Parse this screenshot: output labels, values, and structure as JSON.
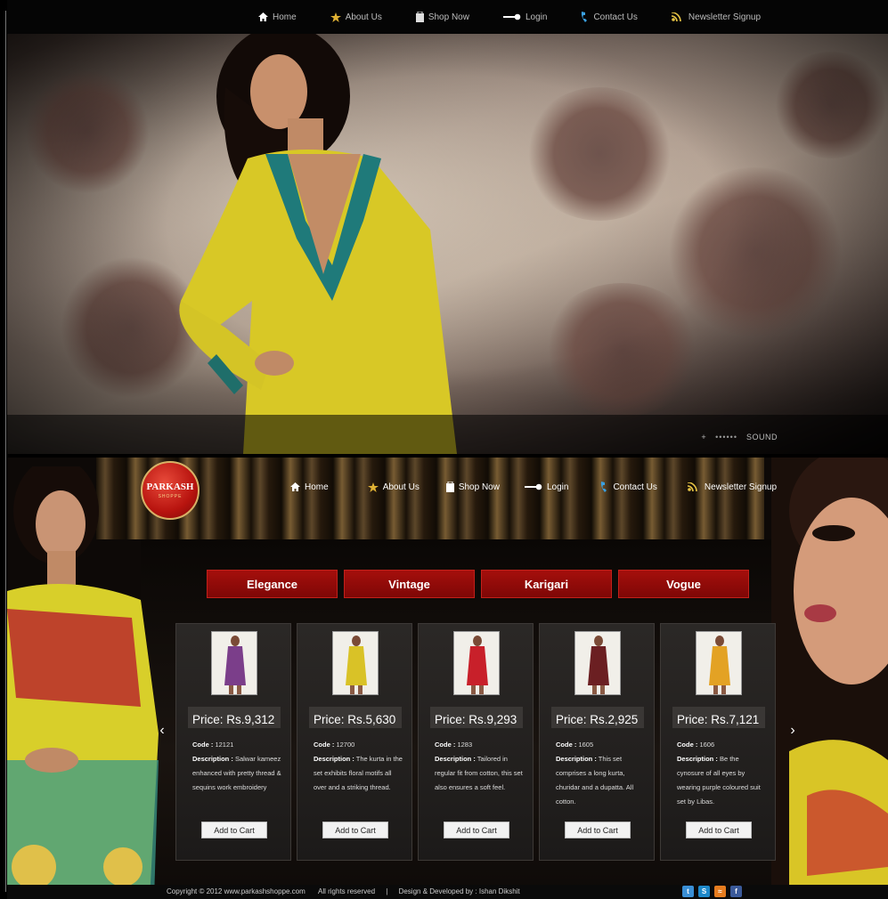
{
  "nav": [
    {
      "label": "Home",
      "icon": "home-icon"
    },
    {
      "label": "About Us",
      "icon": "star-icon"
    },
    {
      "label": "Shop Now",
      "icon": "shopping-bag-icon"
    },
    {
      "label": "Login",
      "icon": "key-icon"
    },
    {
      "label": "Contact Us",
      "icon": "phone-icon"
    },
    {
      "label": "Newsletter Signup",
      "icon": "rss-icon"
    }
  ],
  "hero": {
    "sound_label": "SOUND",
    "plus": "+",
    "dots": "••••••"
  },
  "logo": {
    "word": "PARKASH",
    "sub": "SHOPPE"
  },
  "categories": [
    "Elegance",
    "Vintage",
    "Karigari",
    "Vogue"
  ],
  "arrows": {
    "prev": "‹",
    "next": "›"
  },
  "labels": {
    "code": "Code :",
    "description": "Description :",
    "add_to_cart": "Add to Cart"
  },
  "products": [
    {
      "price": "Price: Rs.9,312",
      "code": "12121",
      "description": "Salwar kameez enhanced with pretty thread & sequins work embroidery",
      "thumb_color": "#7b3e8a"
    },
    {
      "price": "Price: Rs.5,630",
      "code": "12700",
      "description": "The kurta in the set exhibits floral motifs all over and a striking thread.",
      "thumb_color": "#d9c227"
    },
    {
      "price": "Price: Rs.9,293",
      "code": "1283",
      "description": "Tailored in regular fit from cotton, this set also ensures a soft feel.",
      "thumb_color": "#c8202a"
    },
    {
      "price": "Price: Rs.2,925",
      "code": "1605",
      "description": "This set comprises a long kurta, churidar and a dupatta. All cotton.",
      "thumb_color": "#6b1f22"
    },
    {
      "price": "Price: Rs.7,121",
      "code": "1606",
      "description": "Be the cynosure of all eyes by wearing purple coloured suit set by Libas.",
      "thumb_color": "#e3a224"
    }
  ],
  "footer": {
    "copyright": "Copyright © 2012 www.parkashshoppe.com",
    "rights": "All rights reserved",
    "divider": "|",
    "credit": "Design & Developed by : Ishan Dikshit"
  },
  "social": [
    {
      "icon": "twitter-icon",
      "glyph": "t",
      "color": "#3a8fd6"
    },
    {
      "icon": "skype-icon",
      "glyph": "S",
      "color": "#1e88c9"
    },
    {
      "icon": "rss-feed-icon",
      "glyph": "≈",
      "color": "#e67c1f"
    },
    {
      "icon": "facebook-icon",
      "glyph": "f",
      "color": "#3b5a9a"
    }
  ]
}
